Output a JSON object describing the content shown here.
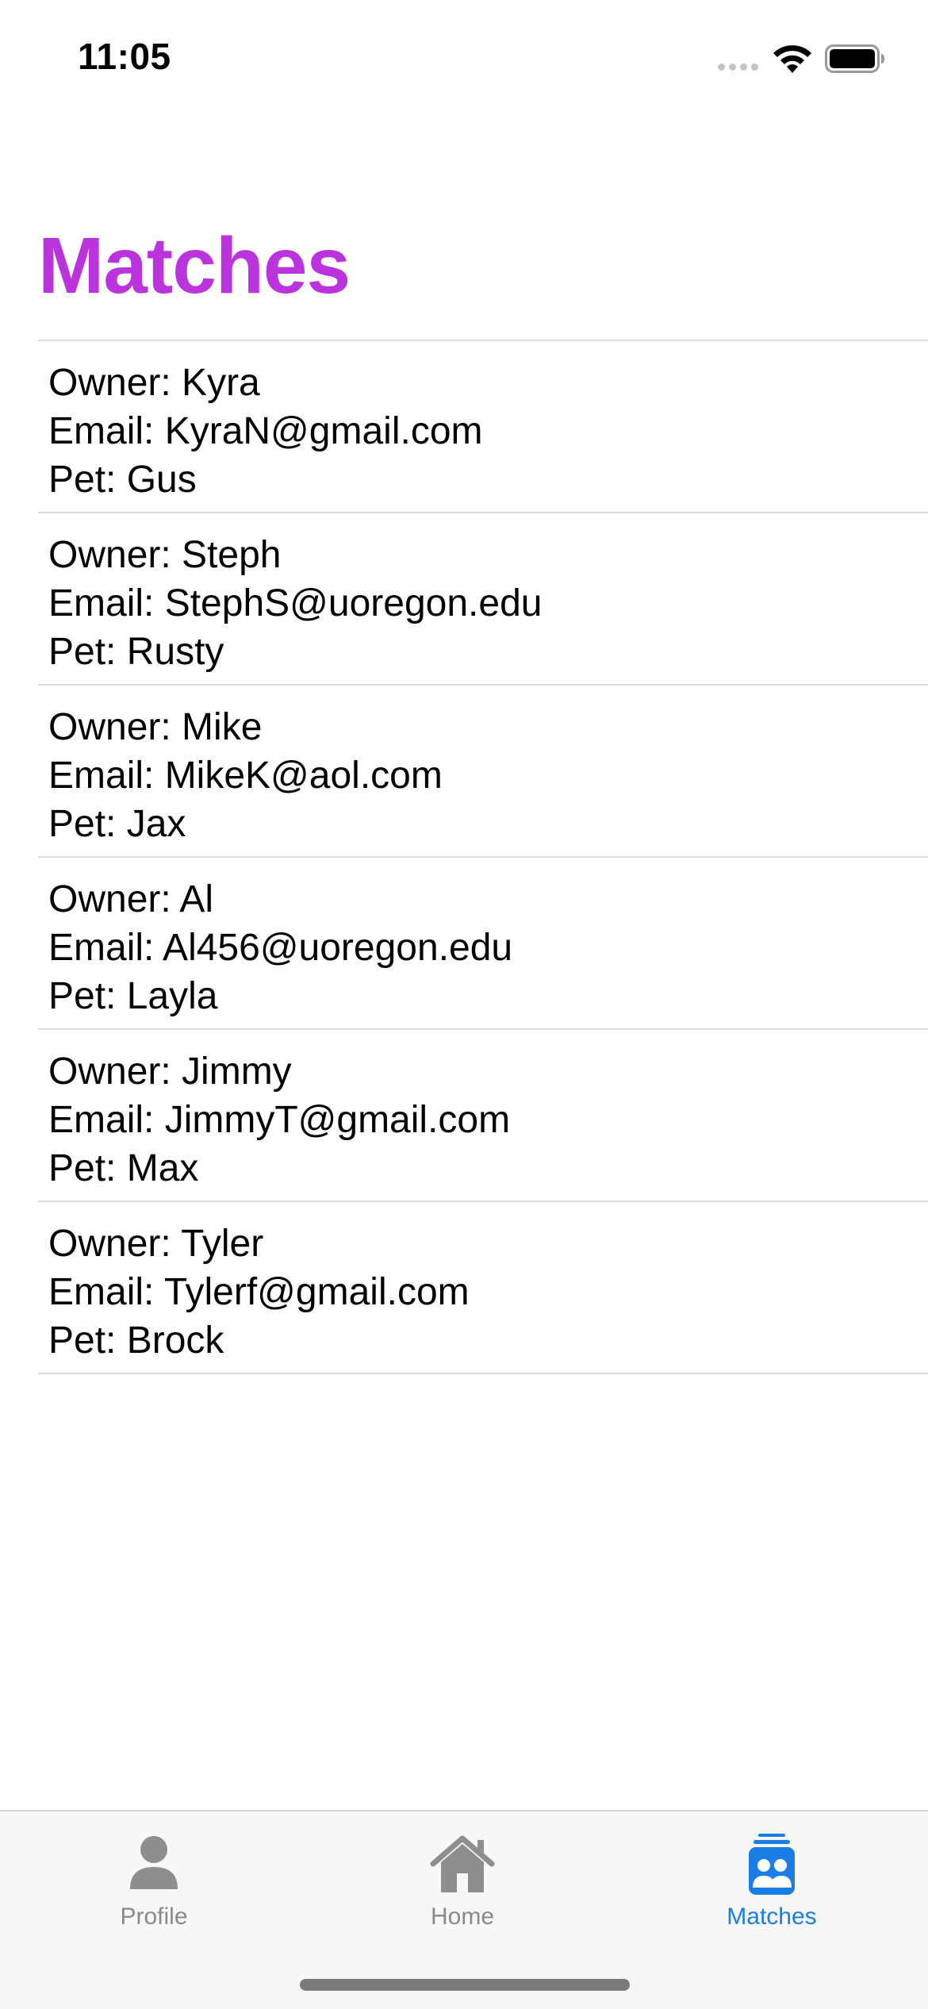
{
  "status_bar": {
    "time": "11:05",
    "icons": [
      "signal-dots-icon",
      "wifi-icon",
      "battery-icon"
    ]
  },
  "page": {
    "title": "Matches",
    "title_color": "#bb33dd"
  },
  "matches": [
    {
      "owner": "Owner: Kyra",
      "email": "Email: KyraN@gmail.com",
      "pet": "Pet: Gus"
    },
    {
      "owner": "Owner: Steph",
      "email": "Email: StephS@uoregon.edu",
      "pet": "Pet: Rusty"
    },
    {
      "owner": "Owner: Mike",
      "email": "Email: MikeK@aol.com",
      "pet": "Pet: Jax"
    },
    {
      "owner": "Owner: Al",
      "email": "Email: Al456@uoregon.edu",
      "pet": "Pet: Layla"
    },
    {
      "owner": "Owner: Jimmy",
      "email": "Email: JimmyT@gmail.com",
      "pet": "Pet: Max"
    },
    {
      "owner": "Owner: Tyler",
      "email": "Email: Tylerf@gmail.com",
      "pet": "Pet: Brock"
    }
  ],
  "tab_bar": {
    "active_color": "#1a7ee6",
    "inactive_color": "#8a8a8a",
    "tabs": [
      {
        "label": "Profile",
        "icon": "person-icon"
      },
      {
        "label": "Home",
        "icon": "house-icon"
      },
      {
        "label": "Matches",
        "icon": "matches-stack-icon",
        "active": true
      }
    ]
  }
}
